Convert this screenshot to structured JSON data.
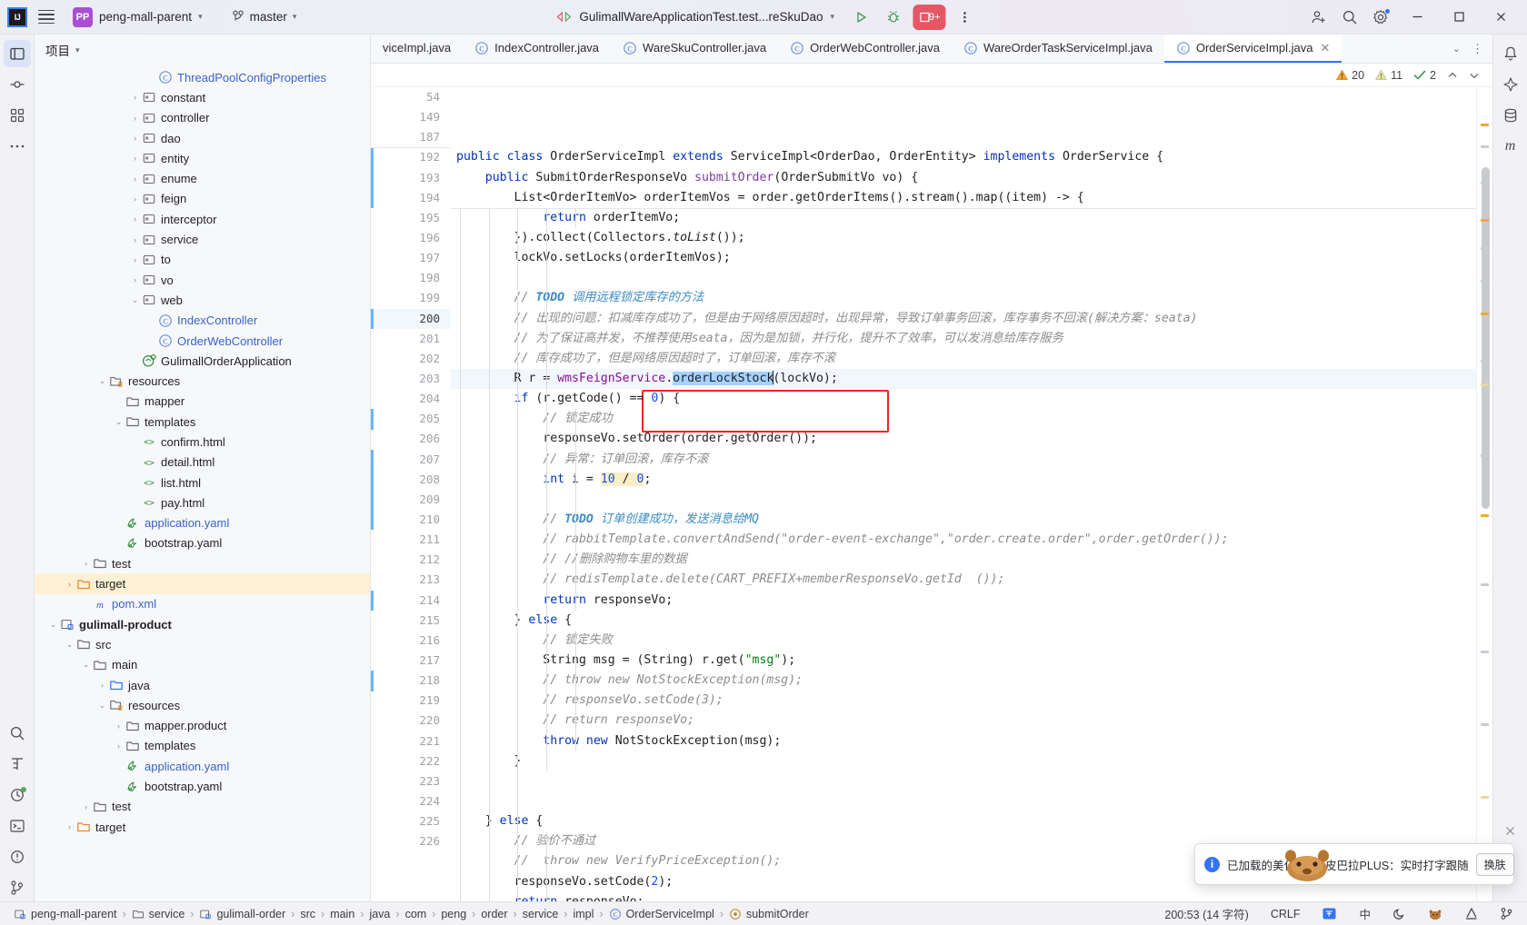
{
  "titlebar": {
    "logo_text": "IJ",
    "project_badge": "PP",
    "project_name": "peng-mall-parent",
    "branch_name": "master",
    "run_config": "GulimallWareApplicationTest.test...reSkuDao",
    "notification_count": "9+",
    "icons": {
      "menu": "hamburger-icon",
      "branch": "git-branch-icon",
      "run": "run-icon",
      "debug": "debug-icon",
      "more": "more-vertical-icon",
      "share": "add-user-icon",
      "search": "search-icon",
      "settings": "gear-icon",
      "minimize": "minimize-icon",
      "maximize": "maximize-icon",
      "close": "close-icon"
    }
  },
  "project_panel": {
    "title": "项目",
    "tree": [
      {
        "indent": 6,
        "arrow": "",
        "icon": "class",
        "label": "ThreadPoolConfigProperties",
        "color": "blue"
      },
      {
        "indent": 5,
        "arrow": "▸",
        "icon": "package",
        "label": "constant"
      },
      {
        "indent": 5,
        "arrow": "▸",
        "icon": "package",
        "label": "controller"
      },
      {
        "indent": 5,
        "arrow": "▸",
        "icon": "package",
        "label": "dao"
      },
      {
        "indent": 5,
        "arrow": "▸",
        "icon": "package",
        "label": "entity"
      },
      {
        "indent": 5,
        "arrow": "▸",
        "icon": "package",
        "label": "enume"
      },
      {
        "indent": 5,
        "arrow": "▸",
        "icon": "package",
        "label": "feign"
      },
      {
        "indent": 5,
        "arrow": "▸",
        "icon": "package",
        "label": "interceptor"
      },
      {
        "indent": 5,
        "arrow": "▸",
        "icon": "package",
        "label": "service"
      },
      {
        "indent": 5,
        "arrow": "▸",
        "icon": "package",
        "label": "to"
      },
      {
        "indent": 5,
        "arrow": "▸",
        "icon": "package",
        "label": "vo"
      },
      {
        "indent": 5,
        "arrow": "▾",
        "icon": "package",
        "label": "web"
      },
      {
        "indent": 6,
        "arrow": "",
        "icon": "class",
        "label": "IndexController",
        "color": "blue"
      },
      {
        "indent": 6,
        "arrow": "",
        "icon": "class",
        "label": "OrderWebController",
        "color": "blue"
      },
      {
        "indent": 5,
        "arrow": "",
        "icon": "springapp",
        "label": "GulimallOrderApplication"
      },
      {
        "indent": 3,
        "arrow": "▾",
        "icon": "resources",
        "label": "resources"
      },
      {
        "indent": 4,
        "arrow": "",
        "icon": "folder",
        "label": "mapper"
      },
      {
        "indent": 4,
        "arrow": "▾",
        "icon": "folder",
        "label": "templates"
      },
      {
        "indent": 5,
        "arrow": "",
        "icon": "html",
        "label": "confirm.html"
      },
      {
        "indent": 5,
        "arrow": "",
        "icon": "html",
        "label": "detail.html"
      },
      {
        "indent": 5,
        "arrow": "",
        "icon": "html",
        "label": "list.html"
      },
      {
        "indent": 5,
        "arrow": "",
        "icon": "html",
        "label": "pay.html"
      },
      {
        "indent": 4,
        "arrow": "",
        "icon": "yaml",
        "label": "application.yaml",
        "color": "blue"
      },
      {
        "indent": 4,
        "arrow": "",
        "icon": "yaml",
        "label": "bootstrap.yaml"
      },
      {
        "indent": 2,
        "arrow": "▸",
        "icon": "folder",
        "label": "test"
      },
      {
        "indent": 1,
        "arrow": "▸",
        "icon": "folder-target",
        "label": "target",
        "highlight": true
      },
      {
        "indent": 2,
        "arrow": "",
        "icon": "maven",
        "label": "pom.xml",
        "color": "blue"
      },
      {
        "indent": 0,
        "arrow": "▾",
        "icon": "module",
        "label": "gulimall-product",
        "bold": true
      },
      {
        "indent": 1,
        "arrow": "▾",
        "icon": "folder",
        "label": "src"
      },
      {
        "indent": 2,
        "arrow": "▾",
        "icon": "folder",
        "label": "main"
      },
      {
        "indent": 3,
        "arrow": "▸",
        "icon": "folder-src",
        "label": "java"
      },
      {
        "indent": 3,
        "arrow": "▾",
        "icon": "resources",
        "label": "resources"
      },
      {
        "indent": 4,
        "arrow": "▸",
        "icon": "folder",
        "label": "mapper.product"
      },
      {
        "indent": 4,
        "arrow": "▸",
        "icon": "folder",
        "label": "templates"
      },
      {
        "indent": 4,
        "arrow": "",
        "icon": "yaml",
        "label": "application.yaml",
        "color": "blue"
      },
      {
        "indent": 4,
        "arrow": "",
        "icon": "yaml",
        "label": "bootstrap.yaml"
      },
      {
        "indent": 2,
        "arrow": "▸",
        "icon": "folder",
        "label": "test"
      },
      {
        "indent": 1,
        "arrow": "▸",
        "icon": "folder-target",
        "label": "target"
      }
    ]
  },
  "tabs": {
    "items": [
      {
        "label": "viceImpl.java",
        "icon": "",
        "active": false,
        "clipped": true
      },
      {
        "label": "IndexController.java",
        "icon": "class",
        "active": false
      },
      {
        "label": "WareSkuController.java",
        "icon": "class",
        "active": false
      },
      {
        "label": "OrderWebController.java",
        "icon": "class",
        "active": false
      },
      {
        "label": "WareOrderTaskServiceImpl.java",
        "icon": "class",
        "active": false
      },
      {
        "label": "OrderServiceImpl.java",
        "icon": "class",
        "active": true
      }
    ]
  },
  "inspections": {
    "warnings": "20",
    "weak_warnings": "11",
    "ok_count": "2"
  },
  "editor": {
    "sticky_lines": [
      {
        "num": "54",
        "html": "<span class=\"kw\">public class</span> OrderServiceImpl <span class=\"kw\">extends</span> ServiceImpl&lt;OrderDao, OrderEntity&gt; <span class=\"kw\">implements</span> OrderService {"
      },
      {
        "num": "149",
        "html": "    <span class=\"kw\">public</span> SubmitOrderResponseVo <span class=\"meth\">submitOrder</span>(OrderSubmitVo vo) {"
      },
      {
        "num": "187",
        "html": "        List&lt;OrderItemVo&gt; orderItemVos = order.getOrderItems().stream().map((item) -&gt; {"
      }
    ],
    "lines": [
      {
        "num": "192",
        "html": "            <span class=\"kw\">return</span> orderItemVo;",
        "indentGuides": [
          1,
          2,
          3,
          4,
          5
        ]
      },
      {
        "num": "193",
        "html": "        }).collect(Collectors.<span class=\"ital\">toList</span>());",
        "indentGuides": [
          1,
          2,
          3,
          4
        ]
      },
      {
        "num": "194",
        "html": "        lockVo.setLocks(orderItemVos);",
        "indentGuides": [
          1,
          2,
          3,
          4
        ]
      },
      {
        "num": "195",
        "html": "",
        "indentGuides": [
          1,
          2,
          3,
          4
        ]
      },
      {
        "num": "196",
        "html": "        <span class=\"cm\">// </span><span class=\"todo\">TODO</span> <span class=\"todotxt\">调用远程锁定库存的方法</span>",
        "indentGuides": [
          1,
          2,
          3,
          4
        ]
      },
      {
        "num": "197",
        "html": "        <span class=\"cm\">// 出现的问题：扣减库存成功了，但是由于网络原因超时，出现异常，导致订单事务回滚，库存事务不回滚(解决方案：seata)</span>",
        "indentGuides": [
          1,
          2,
          3,
          4
        ]
      },
      {
        "num": "198",
        "html": "        <span class=\"cm\">// 为了保证高并发，不推荐使用seata，因为是加锁，并行化，提升不了效率，可以发消息给库存服务</span>",
        "indentGuides": [
          1,
          2,
          3,
          4
        ]
      },
      {
        "num": "199",
        "html": "        <span class=\"cm\">// 库存成功了，但是网络原因超时了，订单回滚，库存不滚</span>",
        "indentGuides": [
          1,
          2,
          3,
          4
        ]
      },
      {
        "num": "200",
        "html": "        R r = <span class=\"field\">wmsFeignService</span>.<span class=\"sel\">orderLockStock</span><span class=\"caret\"></span>(lockVo);",
        "current": true,
        "indentGuides": [
          1,
          2,
          3,
          4
        ]
      },
      {
        "num": "201",
        "html": "        <span class=\"kw\">if</span> (r.getCode() == <span class=\"num\">0</span>) {",
        "indentGuides": [
          1,
          2,
          3,
          4
        ]
      },
      {
        "num": "202",
        "html": "            <span class=\"cm\">// 锁定成功</span>",
        "indentGuides": [
          1,
          2,
          3,
          4,
          5
        ]
      },
      {
        "num": "203",
        "html": "            responseVo.setOrder(order.getOrder());",
        "indentGuides": [
          1,
          2,
          3,
          4,
          5
        ]
      },
      {
        "num": "204",
        "html": "            <span class=\"cm\">// 异常：订单回滚，库存不滚</span>",
        "indentGuides": [
          1,
          2,
          3,
          4,
          5
        ]
      },
      {
        "num": "205",
        "html": "            <span class=\"kw\">int</span> i = <span class=\"num hlnum\">10</span><span class=\"hlnum\"> / </span><span class=\"num hlnum\">0</span>;",
        "indentGuides": [
          1,
          2,
          3,
          4,
          5
        ]
      },
      {
        "num": "206",
        "html": "",
        "indentGuides": [
          1,
          2,
          3,
          4,
          5
        ]
      },
      {
        "num": "207",
        "html": "            <span class=\"cm\">// </span><span class=\"todo\">TODO</span> <span class=\"todotxt\">订单创建成功，发送消息给MQ</span>",
        "indentGuides": [
          1,
          2,
          3,
          4,
          5
        ]
      },
      {
        "num": "208",
        "html": "            <span class=\"cm ital\">// rabbitTemplate.convertAndSend(\"order-event-exchange\",\"order.create.order\",order.getOrder());</span>",
        "indentGuides": [
          1,
          2,
          3,
          4,
          5
        ]
      },
      {
        "num": "209",
        "html": "            <span class=\"cm ital\">// //删除购物车里的数据</span>",
        "indentGuides": [
          1,
          2,
          3,
          4,
          5
        ]
      },
      {
        "num": "210",
        "html": "            <span class=\"cm ital\">// redisTemplate.delete(CART_PREFIX+memberResponseVo.getId  ());</span>",
        "indentGuides": [
          1,
          2,
          3,
          4,
          5
        ]
      },
      {
        "num": "211",
        "html": "            <span class=\"kw\">return</span> responseVo;",
        "indentGuides": [
          1,
          2,
          3,
          4,
          5
        ]
      },
      {
        "num": "212",
        "html": "        } <span class=\"kw\">else</span> {",
        "indentGuides": [
          1,
          2,
          3,
          4
        ]
      },
      {
        "num": "213",
        "html": "            <span class=\"cm\">// 锁定失败</span>",
        "indentGuides": [
          1,
          2,
          3,
          4,
          5
        ]
      },
      {
        "num": "214",
        "html": "            String msg = (String) r.get(<span class=\"str\">\"msg\"</span>);",
        "indentGuides": [
          1,
          2,
          3,
          4,
          5
        ]
      },
      {
        "num": "215",
        "html": "            <span class=\"cm ital\">// throw new NotStockException(msg);</span>",
        "indentGuides": [
          1,
          2,
          3,
          4,
          5
        ]
      },
      {
        "num": "216",
        "html": "            <span class=\"cm ital\">// responseVo.setCode(3);</span>",
        "indentGuides": [
          1,
          2,
          3,
          4,
          5
        ]
      },
      {
        "num": "217",
        "html": "            <span class=\"cm ital\">// return responseVo;</span>",
        "indentGuides": [
          1,
          2,
          3,
          4,
          5
        ]
      },
      {
        "num": "218",
        "html": "            <span class=\"kw\">throw new</span> NotStockException(msg);",
        "indentGuides": [
          1,
          2,
          3,
          4,
          5
        ]
      },
      {
        "num": "219",
        "html": "        }",
        "indentGuides": [
          1,
          2,
          3,
          4
        ]
      },
      {
        "num": "220",
        "html": "",
        "indentGuides": [
          1,
          2,
          3
        ]
      },
      {
        "num": "221",
        "html": "",
        "indentGuides": [
          1,
          2,
          3
        ]
      },
      {
        "num": "222",
        "html": "    } <span class=\"kw\">else</span> {",
        "indentGuides": [
          1,
          2,
          3
        ]
      },
      {
        "num": "223",
        "html": "        <span class=\"cm\">// 验价不通过</span>",
        "indentGuides": [
          1,
          2,
          3,
          4
        ]
      },
      {
        "num": "224",
        "html": "        <span class=\"cm ital\">//  throw new VerifyPriceException();</span>",
        "indentGuides": [
          1,
          2,
          3,
          4
        ]
      },
      {
        "num": "225",
        "html": "        responseVo.setCode(<span class=\"num\">2</span>);",
        "indentGuides": [
          1,
          2,
          3,
          4
        ]
      },
      {
        "num": "226",
        "html": "        <span class=\"kw\">return</span> responseVo;",
        "indentGuides": [
          1,
          2,
          3,
          4
        ]
      }
    ]
  },
  "statusbar": {
    "breadcrumbs": [
      {
        "icon": "module",
        "label": "peng-mall-parent"
      },
      {
        "icon": "folder",
        "label": "service"
      },
      {
        "icon": "module",
        "label": "gulimall-order"
      },
      {
        "icon": "",
        "label": "src"
      },
      {
        "icon": "",
        "label": "main"
      },
      {
        "icon": "",
        "label": "java"
      },
      {
        "icon": "",
        "label": "com"
      },
      {
        "icon": "",
        "label": "peng"
      },
      {
        "icon": "",
        "label": "order"
      },
      {
        "icon": "",
        "label": "service"
      },
      {
        "icon": "",
        "label": "impl"
      },
      {
        "icon": "class",
        "label": "OrderServiceImpl"
      },
      {
        "icon": "method",
        "label": "submitOrder"
      }
    ],
    "caret_position": "200:53 (14 字符)",
    "line_separator": "CRLF",
    "ime_label": "中"
  },
  "notification": {
    "info_icon": "info-icon",
    "text": "已加载的美化包",
    "title": "卡皮巴拉PLUS：实时打字跟随",
    "button": "换肤",
    "close_icon": "close-icon"
  }
}
